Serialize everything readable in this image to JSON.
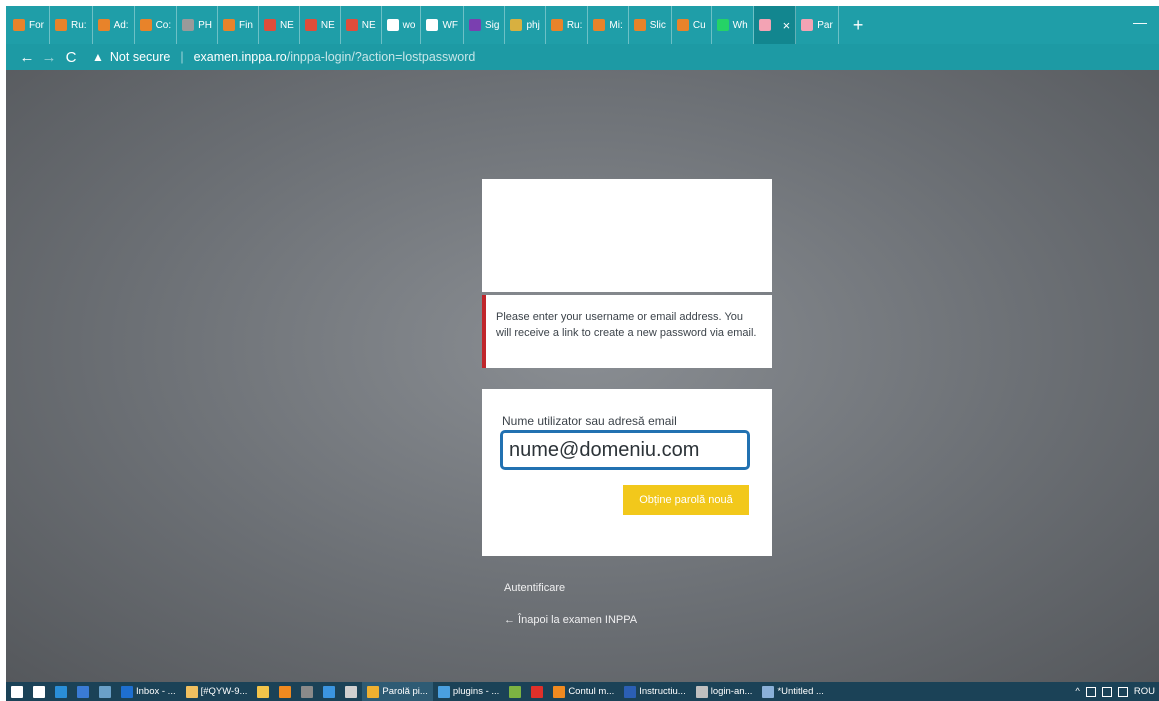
{
  "browser": {
    "tabs": [
      {
        "label": "For",
        "icon": "site-icon",
        "color": "#e8832a"
      },
      {
        "label": "Ru:",
        "icon": "site-icon",
        "color": "#e8832a"
      },
      {
        "label": "Ad:",
        "icon": "site-icon",
        "color": "#e8832a"
      },
      {
        "label": "Co:",
        "icon": "site-icon",
        "color": "#e8832a"
      },
      {
        "label": "PH",
        "icon": "php-icon",
        "color": "#9a9a9a"
      },
      {
        "label": "Fin",
        "icon": "site-icon",
        "color": "#e8832a"
      },
      {
        "label": "NE",
        "icon": "k-icon",
        "color": "#e04d3a"
      },
      {
        "label": "NE",
        "icon": "k-icon",
        "color": "#e04d3a"
      },
      {
        "label": "NE",
        "icon": "k-icon",
        "color": "#e04d3a"
      },
      {
        "label": "wo",
        "icon": "google-icon",
        "color": "#ffffff"
      },
      {
        "label": "WF",
        "icon": "wordpress-icon",
        "color": "#ffffff"
      },
      {
        "label": "Sig",
        "icon": "word-icon",
        "color": "#7a3fb0"
      },
      {
        "label": "phj",
        "icon": "php-icon",
        "color": "#d8b040"
      },
      {
        "label": "Ru:",
        "icon": "site-icon",
        "color": "#e8832a"
      },
      {
        "label": "Mi:",
        "icon": "site-icon",
        "color": "#e8832a"
      },
      {
        "label": "Slic",
        "icon": "site-icon",
        "color": "#e8832a"
      },
      {
        "label": "Cu",
        "icon": "site-icon",
        "color": "#e8832a"
      },
      {
        "label": "Wh",
        "icon": "whatsapp-icon",
        "color": "#25d366"
      },
      {
        "label": "",
        "icon": "site-icon",
        "color": "#f3a3b4",
        "active": true,
        "close": "×"
      },
      {
        "label": "Par",
        "icon": "site-icon",
        "color": "#f3a3b4"
      }
    ],
    "new_tab": "+",
    "minimize": "—",
    "nav": {
      "back": "←",
      "forward": "→",
      "reload": "C"
    },
    "security_label": "Not secure",
    "url_host": "examen.inppa.ro",
    "url_path": "/inppa-login/?action=lostpassword"
  },
  "page": {
    "message": "Please enter your username or email address. You will receive a link to create a new password via email.",
    "field_label": "Nume utilizator sau adresă email",
    "field_value": "nume@domeniu.com",
    "submit_label": "Obține parolă nouă",
    "login_link": "Autentificare",
    "back_link": "← Înapoi la examen INPPA",
    "colors": {
      "accent": "#f2c81b",
      "error_border": "#c0262b",
      "focus": "#2271b1"
    }
  },
  "taskbar": {
    "items": [
      {
        "label": "",
        "icon": "windows-start-icon",
        "color": "#ffffff"
      },
      {
        "label": "",
        "icon": "task-view-icon",
        "color": "#ffffff"
      },
      {
        "label": "",
        "icon": "edge-icon",
        "color": "#2a8fd8"
      },
      {
        "label": "",
        "icon": "app-icon",
        "color": "#3a7bd5"
      },
      {
        "label": "",
        "icon": "app-icon",
        "color": "#6aa0c8"
      },
      {
        "label": "Inbox - ...",
        "icon": "outlook-icon",
        "color": "#1e6fd0"
      },
      {
        "label": "[#QYW-9...",
        "icon": "mail-icon",
        "color": "#f0c060"
      },
      {
        "label": "",
        "icon": "folder-icon",
        "color": "#f3c44a"
      },
      {
        "label": "",
        "icon": "app-icon",
        "color": "#f08a20"
      },
      {
        "label": "",
        "icon": "terminal-icon",
        "color": "#8a8a8a"
      },
      {
        "label": "",
        "icon": "ie-icon",
        "color": "#3b95e0"
      },
      {
        "label": "",
        "icon": "app-icon",
        "color": "#d0d0d0"
      },
      {
        "label": "Parolă pi...",
        "icon": "chrome-icon",
        "color": "#f0b030",
        "active": true
      },
      {
        "label": "plugins - ...",
        "icon": "app-icon",
        "color": "#4aa0e0"
      },
      {
        "label": "",
        "icon": "app-icon",
        "color": "#7cb342"
      },
      {
        "label": "",
        "icon": "opera-icon",
        "color": "#e0302a"
      },
      {
        "label": "Contul m...",
        "icon": "firefox-icon",
        "color": "#f08a20"
      },
      {
        "label": "Instructiu...",
        "icon": "word-icon",
        "color": "#2b5fb5"
      },
      {
        "label": "login-an...",
        "icon": "file-icon",
        "color": "#c0c0c0"
      },
      {
        "label": "*Untitled ...",
        "icon": "notepad-icon",
        "color": "#8ab0d8"
      }
    ],
    "tray": {
      "chevron": "^",
      "lang": "ROU"
    }
  }
}
